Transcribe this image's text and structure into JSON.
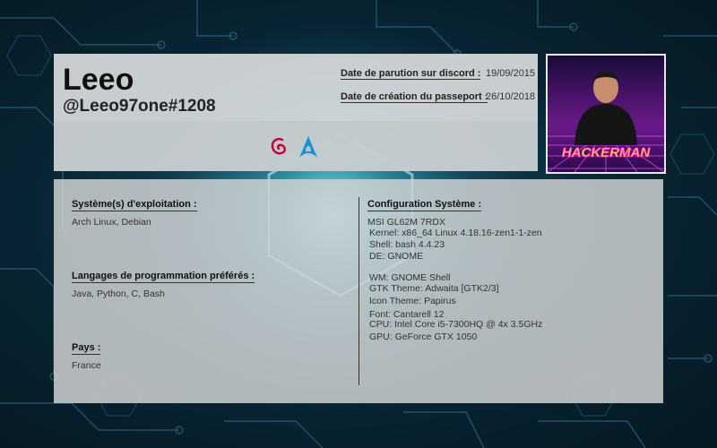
{
  "profile": {
    "name": "Leeo",
    "handle": "@Leeo97one#1208",
    "discord_date_label": "Date de parution sur discord :",
    "discord_date_value": "19/09/2015",
    "passport_date_label": "Date de création du passeport :",
    "passport_date_value": "26/10/2018",
    "avatar_text": "HACKERMAN",
    "icons": [
      "debian-icon",
      "arch-linux-icon"
    ],
    "debian_color": "#c70036",
    "arch_color": "#1793d1"
  },
  "left": {
    "os_title": "Système(s) d'exploitation :",
    "os_value": "Arch Linux, Debian",
    "lang_title": "Langages de programmation préférés :",
    "lang_value": "Java, Python, C, Bash",
    "country_title": "Pays :",
    "country_value": "France"
  },
  "config": {
    "title": "Configuration Système :",
    "lines": [
      "MSI GL62M 7RDX",
      "Kernel: x86_64 Linux 4.18.16-zen1-1-zen",
      "Shell: bash 4.4.23",
      "DE: GNOME",
      "WM: GNOME Shell",
      "GTK Theme: Adwaita [GTK2/3]",
      "Icon Theme: Papirus",
      "Font: Cantarell 12",
      "CPU: Intel Core i5-7300HQ @ 4x 3.5GHz",
      "GPU: GeForce GTX 1050"
    ]
  }
}
